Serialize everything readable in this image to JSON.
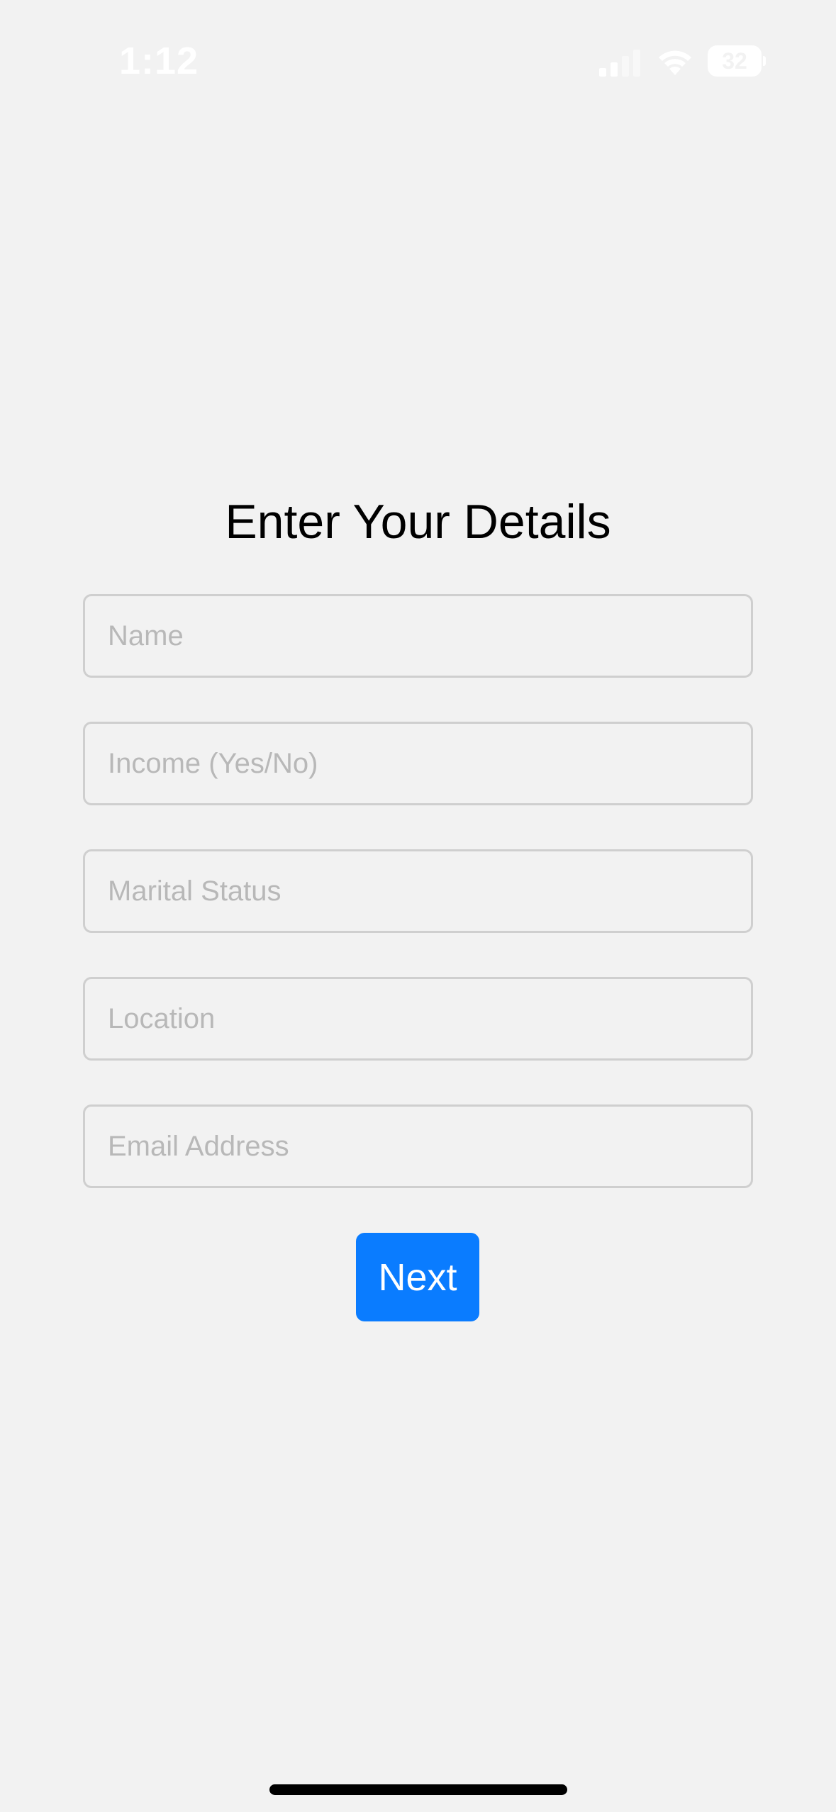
{
  "status_bar": {
    "time": "1:12",
    "battery_level": "32",
    "icons": [
      "cellular-signal-icon",
      "wifi-icon",
      "battery-icon"
    ]
  },
  "form": {
    "title": "Enter Your Details",
    "fields": [
      {
        "placeholder": "Name",
        "value": ""
      },
      {
        "placeholder": "Income (Yes/No)",
        "value": ""
      },
      {
        "placeholder": "Marital Status",
        "value": ""
      },
      {
        "placeholder": "Location",
        "value": ""
      },
      {
        "placeholder": "Email Address",
        "value": ""
      }
    ],
    "next_label": "Next"
  },
  "colors": {
    "background": "#f2f2f2",
    "accent": "#0a7cff",
    "field_border": "#cfcfcf",
    "placeholder": "#b8b8b8"
  }
}
